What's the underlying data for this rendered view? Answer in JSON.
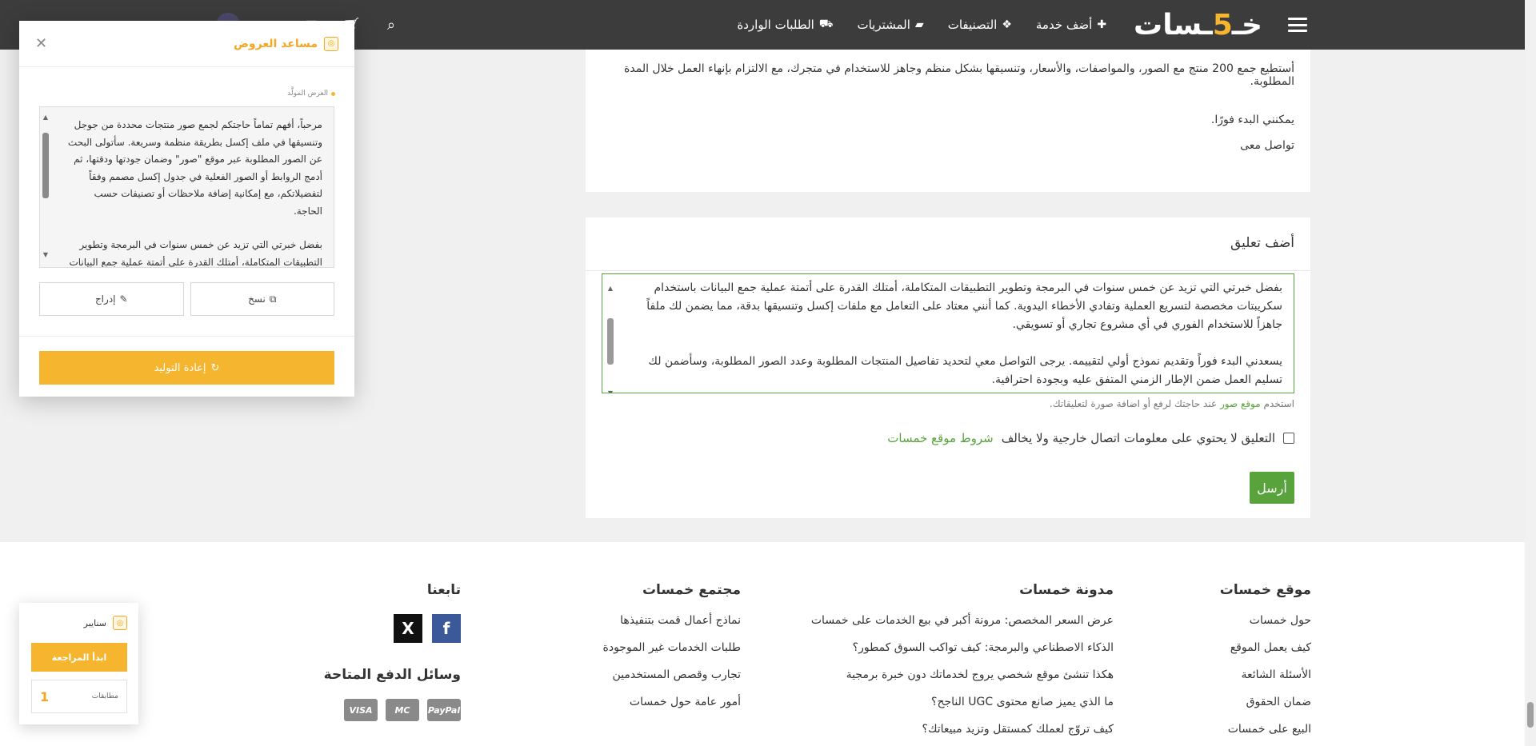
{
  "nav": {
    "logo_text": "خمسات",
    "items": [
      {
        "label": "أضف خدمة",
        "icon": "plus-icon"
      },
      {
        "label": "التصنيفات",
        "icon": "cubes-icon"
      },
      {
        "label": "المشتريات",
        "icon": "folder-icon"
      },
      {
        "label": "الطلبات الواردة",
        "icon": "truck-icon"
      }
    ]
  },
  "offer_excerpt": {
    "line1": "أستطيع جمع 200 منتج مع الصور، والمواصفات، والأسعار، وتنسيقها بشكل منظم وجاهز للاستخدام في متجرك، مع الالتزام بإنهاء العمل خلال المدة المطلوبة.",
    "line2": "يمكنني البدء فورًا.",
    "line3": "تواصل معى"
  },
  "comment": {
    "heading": "أضف تعليق",
    "text_p1": "بفضل خبرتي التي تزيد عن خمس سنوات في البرمجة وتطوير التطبيقات المتكاملة، أمتلك القدرة على أتمتة عملية جمع البيانات باستخدام سكريبتات مخصصة لتسريع العملية وتفادي الأخطاء اليدوية. كما أنني معتاد على التعامل مع ملفات إكسل وتنسيقها بدقة، مما يضمن لك ملفاً جاهزاً للاستخدام الفوري في أي مشروع تجاري أو تسويقي.",
    "text_p2": "يسعدني البدء فوراً وتقديم نموذج أولي لتقييمه. يرجى التواصل معي لتحديد تفاصيل المنتجات المطلوبة وعدد الصور المطلوبة، وسأضمن لك تسليم العمل ضمن الإطار الزمني المتفق عليه وبجودة احترافية.",
    "help_pre": "استخدم",
    "help_link": "موقع صور",
    "help_post": "عند حاجتك لرفع أو اضافة صورة لتعليقاتك.",
    "agree_text": "التعليق لا يحتوي على معلومات اتصال خارجية ولا يخالف",
    "agree_link": "شروط موقع خمسات",
    "send_label": "أرسل"
  },
  "footer": {
    "col1": {
      "title": "موقع خمسات",
      "links": [
        "حول خمسات",
        "كيف يعمل الموقع",
        "الأسئلة الشائعة",
        "ضمان الحقوق",
        "البيع على خمسات"
      ]
    },
    "col2": {
      "title": "مدونة خمسات",
      "links": [
        "عرض السعر المخصص: مرونة أكبر في بيع الخدمات على خمسات",
        "الذكاء الاصطناعي والبرمجة: كيف تواكب السوق كمطور؟",
        "هكذا تنشئ موقع شخصي يروج لخدماتك دون خبرة برمجية",
        "ما الذي يميز صانع محتوى UGC الناجح؟",
        "كيف تروّج لعملك كمستقل وتزيد مبيعاتك؟"
      ]
    },
    "col3": {
      "title": "مجتمع خمسات",
      "links": [
        "نماذج أعمال قمت بتنفيذها",
        "طلبات الخدمات غير الموجودة",
        "تجارب وقصص المستخدمين",
        "أمور عامة حول خمسات"
      ]
    },
    "col4": {
      "title": "تابعنا",
      "payments_title": "وسائل الدفع المتاحة",
      "payments": [
        "PayPal",
        "MC",
        "VISA"
      ]
    }
  },
  "assistant": {
    "title": "مساعد العروض",
    "label": "العرض المولَّد",
    "text_p1": "مرحباً، أفهم تماماً حاجتكم لجمع صور منتجات محددة من جوجل وتنسيقها في ملف إكسل بطريقة منظمة وسريعة. سأتولى البحث عن الصور المطلوبة عبر موقع \"صور\" وضمان جودتها ودقتها، ثم أدمج الروابط أو الصور الفعلية في جدول إكسل مصمم وفقاً لتفضيلاتكم، مع إمكانية إضافة ملاحظات أو تصنيفات حسب الحاجة.",
    "text_p2": "بفضل خبرتي التي تزيد عن خمس سنوات في البرمجة وتطوير التطبيقات المتكاملة، أمتلك القدرة على أتمتة عملية جمع البيانات باستخدام سكريبتات مخصصة لتسريع العملية وتفادي الأخطاء اليدوية. كما أنني",
    "copy_label": "نسخ",
    "insert_label": "إدراج",
    "regen_label": "إعادة التوليد"
  },
  "scanner": {
    "title": "سنايبر",
    "start_label": "ابدأ المراجعة",
    "matches_label": "مطابقات",
    "matches_count": "1"
  },
  "colors": {
    "accent": "#f5b52e",
    "green": "#59a33d",
    "nav_bg": "#3c3c3c"
  }
}
